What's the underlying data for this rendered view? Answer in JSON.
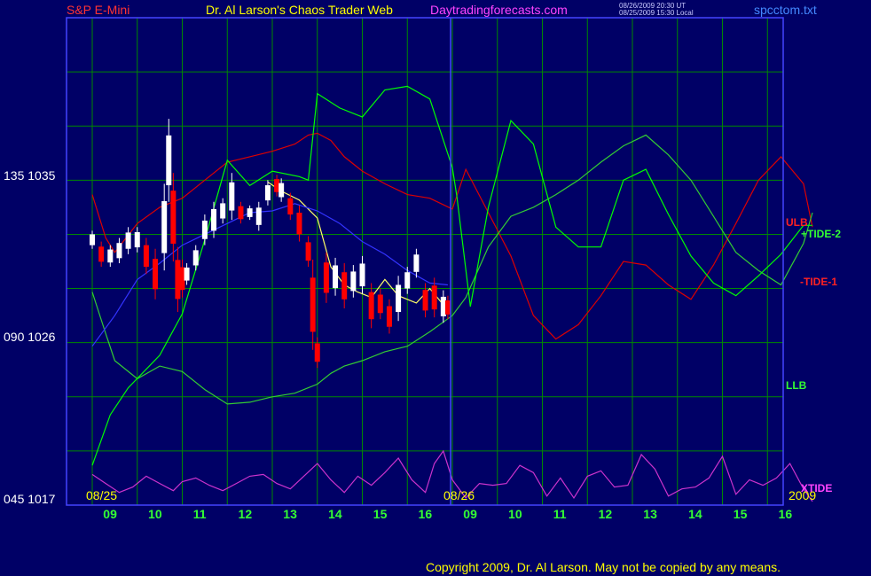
{
  "header": {
    "instrument": "S&P E-Mini",
    "title": "Dr. Al Larson's Chaos Trader Web",
    "site": "Daytradingforecasts.com",
    "stamp_line1": "08/26/2009 20:30 UT",
    "stamp_line2": "08/25/2009 15:30 Local",
    "file": "spcctom.txt"
  },
  "footer": {
    "copyright": "Copyright 2009, Dr. Al Larson. May not be copied by any means."
  },
  "y_labels": [
    {
      "value": 1035,
      "text": "135 1035"
    },
    {
      "value": 1026,
      "text": "090 1026"
    },
    {
      "value": 1017,
      "text": "045 1017"
    }
  ],
  "date_labels": {
    "day1": "08/25",
    "day2": "08/26",
    "year": "2009"
  },
  "series_labels": {
    "ulb": "ULB",
    "tide_plus2": "+TIDE-2",
    "tide_minus1": "-TIDE-1",
    "llb": "LLB",
    "xtide": "XTIDE"
  },
  "colors": {
    "background": "#000066",
    "grid": "#008800",
    "frame": "#4444ff",
    "price_up": "#ffffff",
    "price_down": "#ff0000",
    "ulb": "#dd0000",
    "llb": "#33cc33",
    "tide": "#00ff00",
    "xtide": "#cc33cc",
    "moving_avg": "#ffff66",
    "slow_avg": "#3333ff",
    "title": "#ffff00",
    "instrument": "#ff3333",
    "site": "#ff44ff",
    "file": "#4488ff"
  },
  "chart_data": {
    "type": "line",
    "title": "Dr. Al Larson's Chaos Trader Web",
    "ylim": [
      1017,
      1044
    ],
    "y_ticks": [
      1017,
      1026,
      1035
    ],
    "x_ticks": [
      "09",
      "10",
      "11",
      "12",
      "13",
      "14",
      "15",
      "16",
      "09",
      "10",
      "11",
      "12",
      "13",
      "14",
      "15",
      "16"
    ],
    "series": [
      {
        "name": "ULB",
        "x": [
          0,
          0.3,
          0.5,
          1,
          1.5,
          2,
          2.5,
          3,
          3.5,
          4,
          4.5,
          4.8,
          5,
          5.3,
          5.6,
          6,
          6.5,
          7,
          7.5,
          8,
          8.3,
          8.8,
          9.3,
          9.8,
          10.3,
          10.8,
          11.3,
          11.8,
          12.3,
          12.8,
          13.3,
          13.8,
          14.3,
          14.8,
          15.3,
          15.8,
          16
        ],
        "values": [
          1034.2,
          1031.8,
          1031,
          1032.6,
          1033.5,
          1034,
          1035,
          1036,
          1036.3,
          1036.6,
          1037,
          1037.5,
          1037.6,
          1037.2,
          1036.3,
          1035.5,
          1034.8,
          1034.2,
          1034,
          1033.4,
          1035.6,
          1033.2,
          1030.8,
          1027.5,
          1026.2,
          1027,
          1028.6,
          1030.5,
          1030.3,
          1029.2,
          1028.4,
          1030.3,
          1032.6,
          1035,
          1036.3,
          1034.8,
          1032.4
        ]
      },
      {
        "name": "LLB",
        "x": [
          0,
          0.3,
          0.5,
          1,
          1.5,
          2,
          2.5,
          3,
          3.5,
          4,
          4.5,
          4.8,
          5,
          5.3,
          5.6,
          6,
          6.5,
          7,
          7.5,
          8,
          8.3,
          8.8,
          9.3,
          9.8,
          10.3,
          10.8,
          11.3,
          11.8,
          12.3,
          12.8,
          13.3,
          13.8,
          14.3,
          14.8,
          15.3,
          15.8,
          16
        ],
        "values": [
          1028.8,
          1026.5,
          1025,
          1024,
          1024.7,
          1024.4,
          1023.4,
          1022.6,
          1022.7,
          1023,
          1023.2,
          1023.5,
          1023.7,
          1024.3,
          1024.7,
          1025,
          1025.5,
          1025.8,
          1026.6,
          1027.5,
          1028.5,
          1031.3,
          1033,
          1033.5,
          1034.2,
          1035,
          1036,
          1036.9,
          1037.5,
          1036.4,
          1035,
          1033,
          1031,
          1030,
          1029.2,
          1031.5,
          1033.2
        ]
      },
      {
        "name": "TIDE",
        "x": [
          0,
          0.4,
          0.8,
          1.5,
          2,
          2.5,
          3,
          3.5,
          4,
          4.6,
          4.8,
          5,
          5.5,
          6,
          6.5,
          7,
          7.5,
          8,
          8.1,
          8.4,
          8.8,
          9.3,
          9.8,
          10.3,
          10.8,
          11.3,
          11.8,
          12.3,
          12.8,
          13.3,
          13.8,
          14.3,
          14.8,
          15.3,
          15.8,
          16
        ],
        "values": [
          1019.2,
          1022,
          1023.5,
          1025.3,
          1027.6,
          1031.7,
          1036.1,
          1034.7,
          1035.5,
          1035.2,
          1035,
          1039.8,
          1039,
          1038.5,
          1040,
          1040.2,
          1039.5,
          1035.7,
          1034.1,
          1028,
          1033.5,
          1038.3,
          1037,
          1032.4,
          1031.3,
          1031.3,
          1035,
          1035.6,
          1033.1,
          1030.8,
          1029.3,
          1028.6,
          1029.7,
          1030.9,
          1032.5,
          1032.5
        ]
      },
      {
        "name": "XTIDE",
        "x": [
          0,
          0.3,
          0.6,
          0.9,
          1.2,
          1.5,
          1.8,
          2,
          2.3,
          2.6,
          2.9,
          3.2,
          3.5,
          3.8,
          4.1,
          4.4,
          4.7,
          5,
          5.3,
          5.6,
          5.9,
          6.2,
          6.5,
          6.8,
          7.1,
          7.4,
          7.6,
          7.8,
          8,
          8.3,
          8.6,
          8.9,
          9.2,
          9.5,
          9.8,
          10.1,
          10.4,
          10.7,
          11,
          11.3,
          11.6,
          11.9,
          12.2,
          12.5,
          12.8,
          13.1,
          13.4,
          13.7,
          14,
          14.3,
          14.6,
          14.9,
          15.2,
          15.5,
          15.8,
          16
        ],
        "values": [
          1018.7,
          1018.2,
          1017.7,
          1018,
          1018.6,
          1018.2,
          1017.8,
          1018.3,
          1018.5,
          1018.1,
          1017.8,
          1018.2,
          1018.6,
          1018.7,
          1018.2,
          1017.9,
          1018.6,
          1019.3,
          1018.4,
          1017.7,
          1018.6,
          1018.1,
          1018.8,
          1019.6,
          1018.4,
          1017.7,
          1019.3,
          1020,
          1018.4,
          1017.4,
          1018.2,
          1018.1,
          1018.2,
          1019.2,
          1018.8,
          1017.5,
          1018.5,
          1017.4,
          1018.6,
          1018.9,
          1018,
          1018.1,
          1019.8,
          1019,
          1017.5,
          1017.9,
          1018,
          1018.5,
          1019.7,
          1017.6,
          1018.4,
          1018.1,
          1018.5,
          1019.3,
          1017.9,
          1017.2
        ]
      },
      {
        "name": "Moving average",
        "x": [
          3.9,
          4.2,
          4.6,
          5,
          5.3,
          5.6,
          5.9,
          6.2,
          6.5,
          6.8,
          7.2,
          7.5,
          7.9
        ],
        "values": [
          1034.9,
          1034.4,
          1033.9,
          1032.9,
          1030.2,
          1029.2,
          1028.8,
          1028.5,
          1029.5,
          1028.6,
          1028.2,
          1029,
          1027.8
        ]
      },
      {
        "name": "Slow average",
        "x": [
          0,
          0.5,
          1,
          1.5,
          2,
          2.5,
          3,
          3.5,
          4,
          4.5,
          5,
          5.5,
          6,
          6.5,
          7,
          7.5,
          7.9
        ],
        "values": [
          1025.8,
          1027.5,
          1029.5,
          1030.4,
          1031.4,
          1032,
          1032.6,
          1033.2,
          1033.3,
          1033.7,
          1033.3,
          1032.6,
          1031.6,
          1030.9,
          1030,
          1029.3,
          1029.2
        ]
      }
    ],
    "price_bars": {
      "up_color": "#ffffff",
      "down_color": "#ff0000",
      "x": [
        0,
        0.2,
        0.4,
        0.6,
        0.8,
        1,
        1.2,
        1.4,
        1.6,
        1.7,
        1.8,
        1.9,
        2,
        2.1,
        2.3,
        2.5,
        2.7,
        2.9,
        3.1,
        3.3,
        3.5,
        3.7,
        3.9,
        4.1,
        4.2,
        4.4,
        4.6,
        4.8,
        4.9,
        5,
        5.2,
        5.4,
        5.6,
        5.8,
        6,
        6.2,
        6.4,
        6.6,
        6.8,
        7,
        7.2,
        7.4,
        7.6,
        7.8,
        7.9
      ],
      "high": [
        1032.2,
        1031.6,
        1031.4,
        1031.8,
        1032.4,
        1032.4,
        1031.8,
        1031.2,
        1034.8,
        1038.4,
        1035.4,
        1031.3,
        1030.6,
        1030.4,
        1031.4,
        1033.1,
        1033.8,
        1034,
        1035.4,
        1033.8,
        1033.6,
        1033.8,
        1035,
        1035.3,
        1035.1,
        1034.3,
        1033.6,
        1031.9,
        1030.6,
        1026.3,
        1031,
        1030.7,
        1030.4,
        1030.3,
        1030.8,
        1029.3,
        1029,
        1028.4,
        1029.7,
        1030.2,
        1031.2,
        1029.3,
        1029.6,
        1028.9,
        1028.6
      ],
      "low": [
        1031.2,
        1030.2,
        1030.2,
        1030.4,
        1030.9,
        1031,
        1029.8,
        1028.4,
        1030,
        1033.8,
        1030.5,
        1027.7,
        1028.5,
        1029.2,
        1030,
        1031.4,
        1031.8,
        1032.6,
        1032.8,
        1032.6,
        1032.8,
        1032.2,
        1033.6,
        1034.1,
        1033.8,
        1032.8,
        1031.6,
        1030.2,
        1025.6,
        1024.6,
        1028.2,
        1028.6,
        1027.9,
        1028.5,
        1028.7,
        1026.8,
        1027.3,
        1026.5,
        1027.2,
        1028.7,
        1029.6,
        1027.4,
        1027.4,
        1027.1,
        1027.3
      ],
      "up": [
        true,
        false,
        true,
        true,
        true,
        true,
        false,
        false,
        true,
        true,
        false,
        false,
        false,
        true,
        true,
        true,
        true,
        true,
        true,
        false,
        true,
        true,
        true,
        false,
        true,
        false,
        false,
        false,
        false,
        false,
        false,
        true,
        false,
        true,
        true,
        false,
        false,
        false,
        true,
        true,
        true,
        false,
        false,
        true,
        false
      ]
    }
  }
}
